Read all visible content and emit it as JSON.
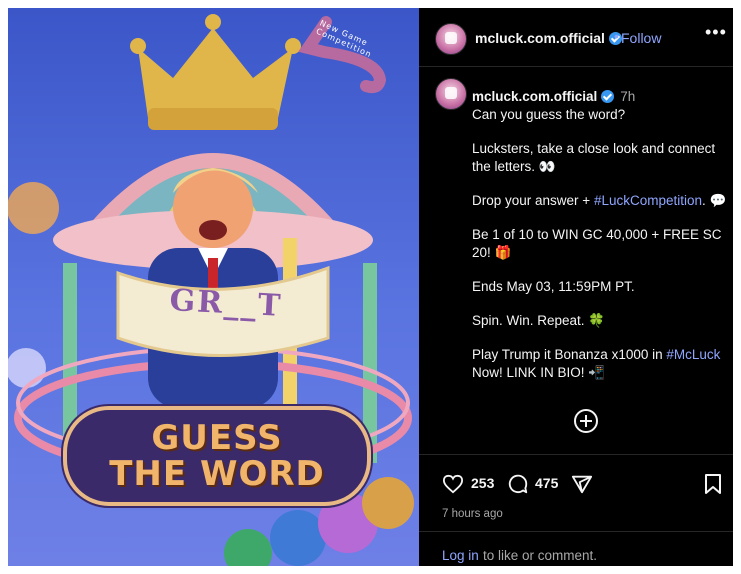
{
  "post_image": {
    "badge_line1": "GUESS",
    "badge_line2": "THE WORD",
    "banner": "GR__T",
    "arrow_label": "New Game Competition"
  },
  "header": {
    "username": "mcluck.com.official",
    "separator": "•",
    "follow_label": "Follow",
    "more_icon": "more-horizontal-icon"
  },
  "caption": {
    "username": "mcluck.com.official",
    "time": "7h",
    "lines": {
      "l1": "Can you guess the word?",
      "l2": "Lucksters, take a close look and connect the letters. 👀",
      "l3a": "Drop your answer + ",
      "l3tag": "#LuckCompetition",
      "l3b": ". 💬",
      "l4": "Be 1 of 10 to WIN GC 40,000 + FREE SC 20! 🎁",
      "l5": "Ends May 03, 11:59PM PT.",
      "l6": "Spin. Win. Repeat. 🍀",
      "l7a": "Play Trump it Bonanza x1000 in ",
      "l7tag": "#McLuck",
      "l7b": " Now! LINK IN BIO! 📲"
    }
  },
  "actions": {
    "likes": "253",
    "comments": "475",
    "posted_ago": "7 hours ago"
  },
  "footer": {
    "login_label": "Log in",
    "login_suffix": "to like or comment."
  },
  "colors": {
    "accent": "#8fa6ff",
    "background": "#000000",
    "muted": "#a8a8a8"
  }
}
